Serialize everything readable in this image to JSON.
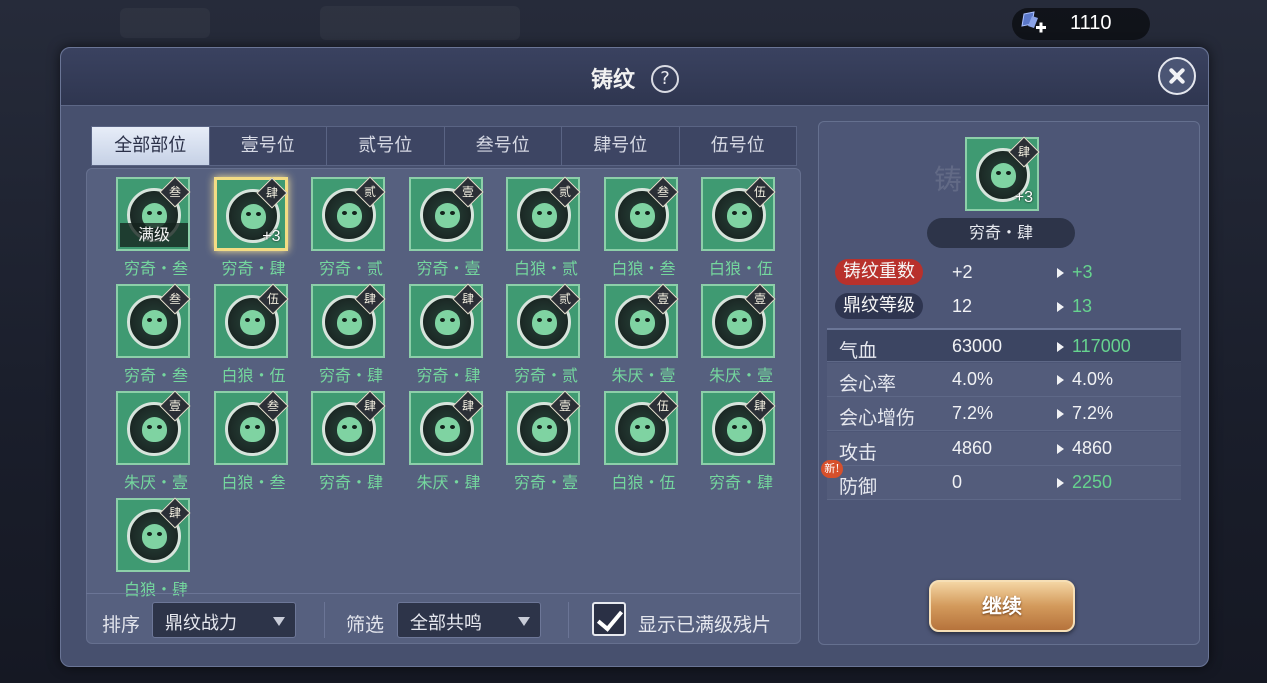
{
  "currency": {
    "icon": "crystal-plus-icon",
    "amount": "1110"
  },
  "modal": {
    "title": "铸纹",
    "help_label": "?",
    "tabs": [
      {
        "label": "全部部位",
        "active": true
      },
      {
        "label": "壹号位",
        "active": false
      },
      {
        "label": "贰号位",
        "active": false
      },
      {
        "label": "叁号位",
        "active": false
      },
      {
        "label": "肆号位",
        "active": false
      },
      {
        "label": "伍号位",
        "active": false
      }
    ]
  },
  "items": [
    {
      "rank": "叁",
      "name": "穷奇・叁",
      "tag": "满级",
      "plus": ""
    },
    {
      "rank": "肆",
      "name": "穷奇・肆",
      "tag": "",
      "plus": "+3",
      "selected": true
    },
    {
      "rank": "贰",
      "name": "穷奇・贰",
      "tag": "",
      "plus": ""
    },
    {
      "rank": "壹",
      "name": "穷奇・壹",
      "tag": "",
      "plus": ""
    },
    {
      "rank": "贰",
      "name": "白狼・贰",
      "tag": "",
      "plus": ""
    },
    {
      "rank": "叁",
      "name": "白狼・叁",
      "tag": "",
      "plus": ""
    },
    {
      "rank": "伍",
      "name": "白狼・伍",
      "tag": "",
      "plus": ""
    },
    {
      "rank": "叁",
      "name": "穷奇・叁",
      "tag": "",
      "plus": ""
    },
    {
      "rank": "伍",
      "name": "白狼・伍",
      "tag": "",
      "plus": ""
    },
    {
      "rank": "肆",
      "name": "穷奇・肆",
      "tag": "",
      "plus": ""
    },
    {
      "rank": "肆",
      "name": "穷奇・肆",
      "tag": "",
      "plus": ""
    },
    {
      "rank": "贰",
      "name": "穷奇・贰",
      "tag": "",
      "plus": ""
    },
    {
      "rank": "壹",
      "name": "朱厌・壹",
      "tag": "",
      "plus": ""
    },
    {
      "rank": "壹",
      "name": "朱厌・壹",
      "tag": "",
      "plus": ""
    },
    {
      "rank": "壹",
      "name": "朱厌・壹",
      "tag": "",
      "plus": ""
    },
    {
      "rank": "叁",
      "name": "白狼・叁",
      "tag": "",
      "plus": ""
    },
    {
      "rank": "肆",
      "name": "穷奇・肆",
      "tag": "",
      "plus": ""
    },
    {
      "rank": "肆",
      "name": "朱厌・肆",
      "tag": "",
      "plus": ""
    },
    {
      "rank": "壹",
      "name": "穷奇・壹",
      "tag": "",
      "plus": ""
    },
    {
      "rank": "伍",
      "name": "白狼・伍",
      "tag": "",
      "plus": ""
    },
    {
      "rank": "肆",
      "name": "穷奇・肆",
      "tag": "",
      "plus": ""
    },
    {
      "rank": "肆",
      "name": "白狼・肆",
      "tag": "",
      "plus": ""
    }
  ],
  "bottom": {
    "sort_label": "排序",
    "sort_value": "鼎纹战力",
    "filter_label": "筛选",
    "filter_value": "全部共鸣",
    "show_full_checked": true,
    "show_full_label": "显示已满级残片"
  },
  "detail": {
    "watermark": "铸纹功",
    "preview": {
      "rank": "肆",
      "plus": "+3"
    },
    "name": "穷奇・肆",
    "forge_count": {
      "label": "铸纹重数",
      "current": "+2",
      "next": "+3",
      "color": "#b8312c"
    },
    "grade": {
      "label": "鼎纹等级",
      "current": "12",
      "next": "13",
      "color": "#2e3550"
    },
    "stats": [
      {
        "label": "气血",
        "current": "63000",
        "next": "117000",
        "up": true,
        "new": false
      },
      {
        "label": "会心率",
        "current": "4.0%",
        "next": "4.0%",
        "up": false,
        "new": false
      },
      {
        "label": "会心增伤",
        "current": "7.2%",
        "next": "7.2%",
        "up": false,
        "new": false
      },
      {
        "label": "攻击",
        "current": "4860",
        "next": "4860",
        "up": false,
        "new": false
      },
      {
        "label": "防御",
        "current": "0",
        "next": "2250",
        "up": true,
        "new": true,
        "new_label": "新!"
      }
    ],
    "continue_label": "继续"
  }
}
